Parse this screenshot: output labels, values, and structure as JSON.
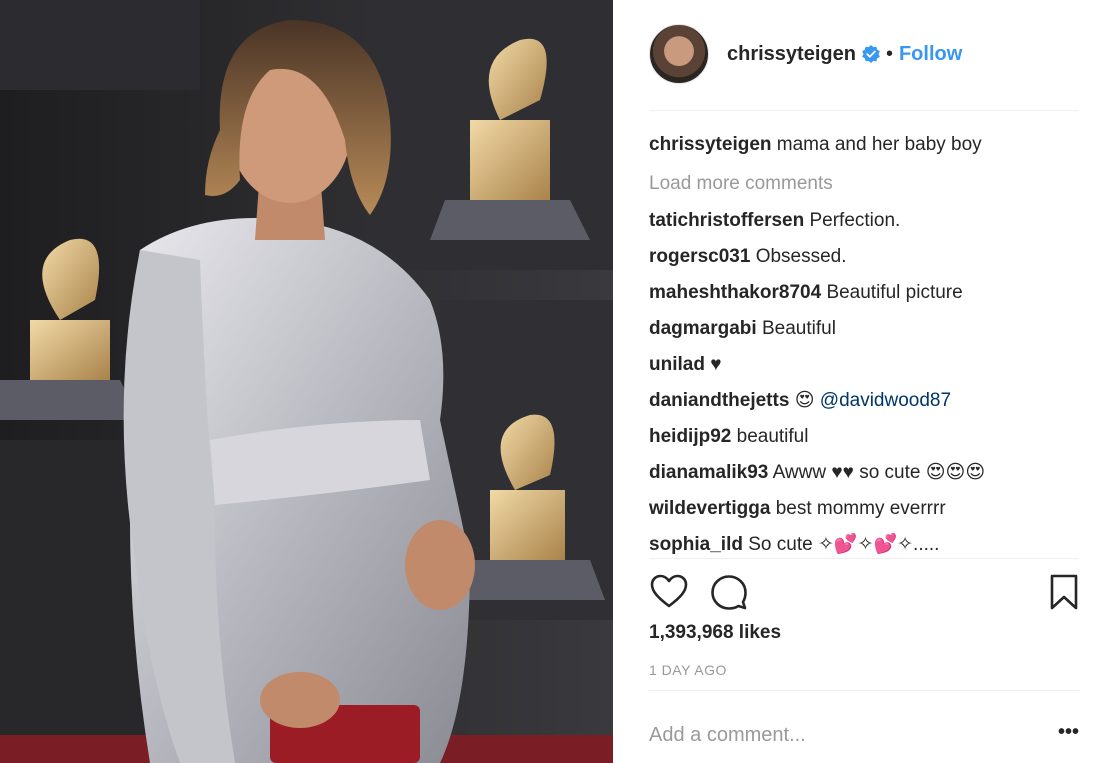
{
  "post": {
    "username": "chrissyteigen",
    "follow_label": "Follow",
    "separator": "•",
    "caption": {
      "user": "chrissyteigen",
      "text": "mama and her baby boy"
    },
    "load_more_label": "Load more comments",
    "comments": [
      {
        "user": "tatichristoffersen",
        "text": "Perfection.",
        "mention": ""
      },
      {
        "user": "rogersc031",
        "text": "Obsessed.",
        "mention": ""
      },
      {
        "user": "maheshthakor8704",
        "text": "Beautiful picture",
        "mention": ""
      },
      {
        "user": "dagmargabi",
        "text": "Beautiful",
        "mention": ""
      },
      {
        "user": "unilad",
        "text": "♥",
        "mention": ""
      },
      {
        "user": "daniandthejetts",
        "text": "😍",
        "mention": "@davidwood87"
      },
      {
        "user": "heidijp92",
        "text": "beautiful",
        "mention": ""
      },
      {
        "user": "dianamalik93",
        "text": "Awww ♥♥ so cute 😍😍😍",
        "mention": ""
      },
      {
        "user": "wildevertigga",
        "text": "best mommy everrrr",
        "mention": ""
      },
      {
        "user": "sophia_ild",
        "text": "So cute ✧💕✧💕✧.....",
        "mention": ""
      }
    ],
    "likes_text": "1,393,968 likes",
    "time_text": "1 DAY AGO",
    "add_comment_placeholder": "Add a comment...",
    "more_label": "•••",
    "colors": {
      "link": "#3897f0",
      "mention": "#003569",
      "muted": "#999999",
      "text": "#262626"
    }
  }
}
